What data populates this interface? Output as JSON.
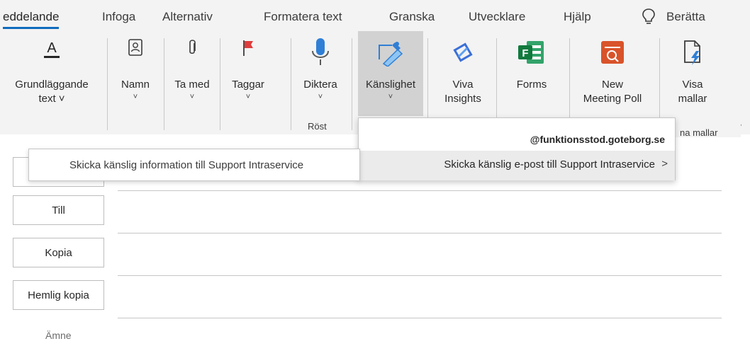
{
  "tabs": [
    "eddelande",
    "Infoga",
    "Alternativ",
    "Formatera text",
    "Granska",
    "Utvecklare",
    "Hjälp"
  ],
  "tell_me": "Berätta",
  "ribbon": {
    "buttons": [
      {
        "label": "Grundläggande",
        "label2": "text ˅"
      },
      {
        "label": "Namn",
        "chevron": "˅"
      },
      {
        "label": "Ta med",
        "chevron": "˅"
      },
      {
        "label": "Taggar",
        "chevron": "˅"
      },
      {
        "label": "Diktera",
        "chevron": "˅"
      },
      {
        "label": "Känslighet",
        "chevron": "˅"
      },
      {
        "label": "Viva",
        "label2": "Insights"
      },
      {
        "label": "Forms"
      },
      {
        "label": "New",
        "label2": "Meeting Poll"
      },
      {
        "label": "Visa",
        "label2": "mallar"
      }
    ],
    "group_rost": "Röst",
    "group_mallar": "na mallar",
    "collapse": "^"
  },
  "sensitivity_menu": {
    "header": "@funktionsstod.goteborg.se",
    "item": "Skicka känslig e-post till Support Intraservice",
    "arrow": ">"
  },
  "tooltip": "Skicka känslig information till Support Intraservice",
  "fields": {
    "till": "Till",
    "kopia": "Kopia",
    "hemlig": "Hemlig kopia",
    "amne": "Ämne"
  },
  "colors": {
    "accent": "#0f6cbd",
    "forms_green": "#117a3d",
    "poll_orange": "#d9532a"
  }
}
